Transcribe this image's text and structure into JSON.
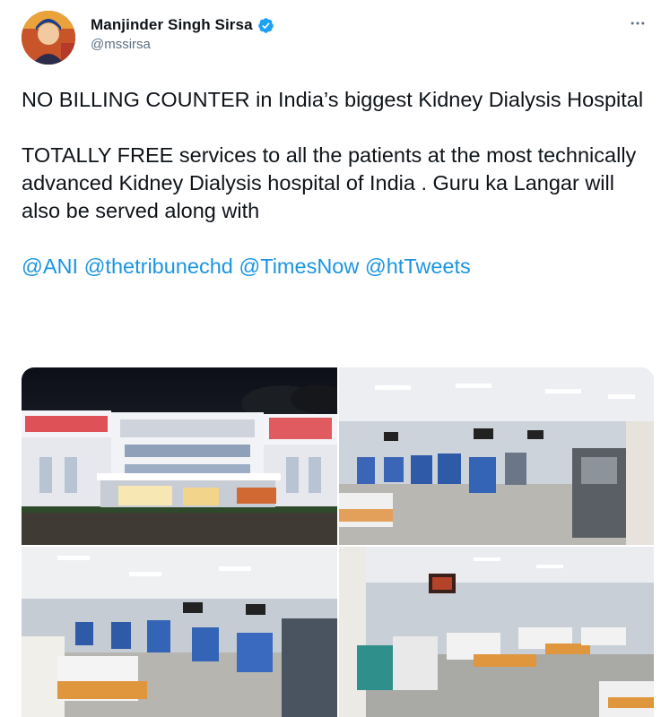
{
  "author": {
    "display_name": "Manjinder Singh Sirsa",
    "handle": "@mssirsa",
    "verified": true
  },
  "more_icon": "more-horizontal-icon",
  "tweet": {
    "paragraph1": "NO BILLING COUNTER in India’s biggest Kidney Dialysis Hospital",
    "paragraph2": "TOTALLY FREE services to all the patients at the most technically advanced Kidney Dialysis hospital of India . Guru ka Langar will also be served along with",
    "mentions": [
      "@ANI",
      "@thetribunechd",
      "@TimesNow",
      "@htTweets"
    ]
  },
  "media": {
    "photos": [
      {
        "id": "photo-1",
        "icon": "hospital-exterior-night-photo"
      },
      {
        "id": "photo-2",
        "icon": "dialysis-ward-photo"
      },
      {
        "id": "photo-3",
        "icon": "dialysis-ward-photo"
      },
      {
        "id": "photo-4",
        "icon": "dialysis-ward-photo"
      }
    ]
  },
  "colors": {
    "text": "#0f1419",
    "secondary": "#5b7083",
    "link": "#1b95e0",
    "verified": "#1da1f2"
  }
}
